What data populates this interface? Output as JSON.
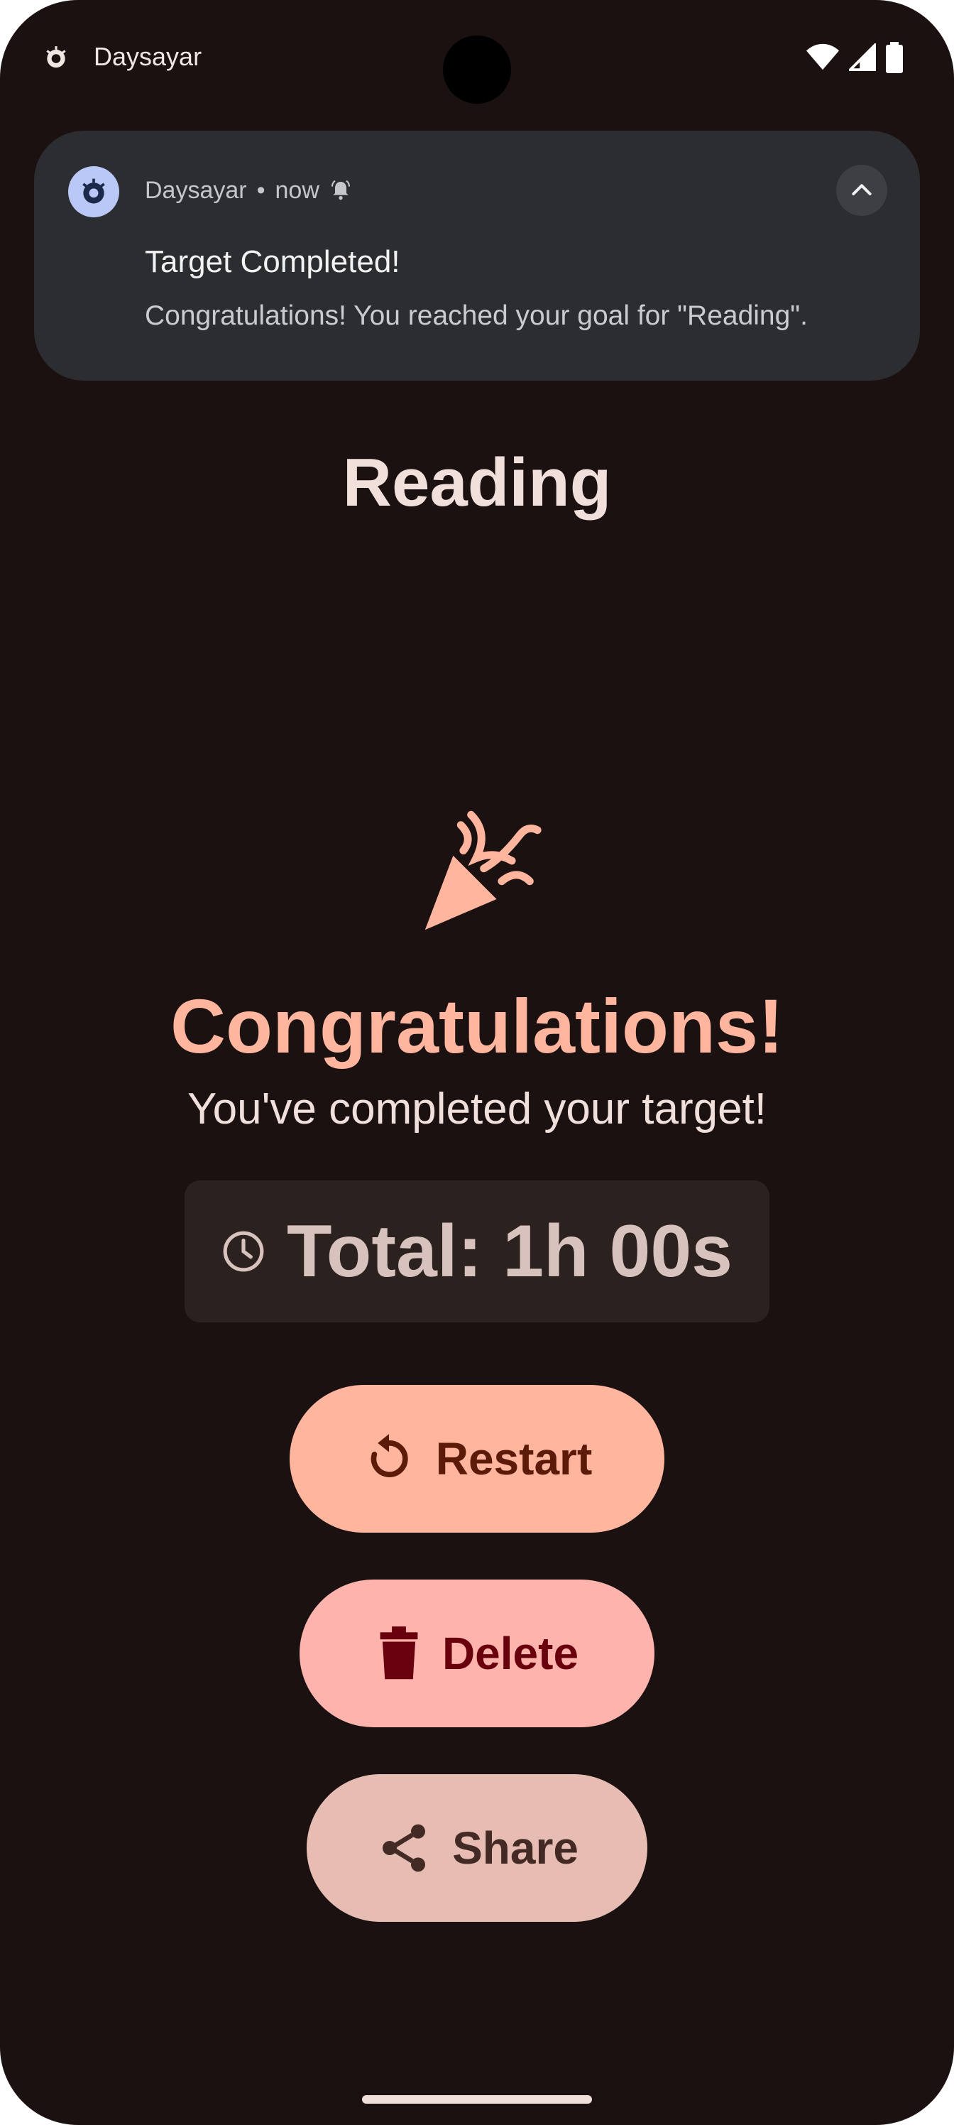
{
  "status_bar": {
    "app_name": "Daysayar",
    "icons": [
      "app-icon",
      "wifi-icon",
      "signal-icon",
      "battery-icon"
    ]
  },
  "notification": {
    "app_name": "Daysayar",
    "separator": "•",
    "time": "now",
    "title": "Target Completed!",
    "body": "Congratulations! You reached your goal for \"Reading\".",
    "icons": [
      "app-avatar-icon",
      "bell-icon",
      "chevron-up-icon"
    ]
  },
  "main": {
    "title": "Reading",
    "congrats": "Congratulations!",
    "subtitle": "You've completed your target!",
    "total": "Total: 1h 00s"
  },
  "buttons": {
    "restart": "Restart",
    "delete": "Delete",
    "share": "Share"
  },
  "colors": {
    "background": "#1a1110",
    "accent": "#ffb59e",
    "restart_bg": "#ffb59e",
    "delete_bg": "#ffb3ad",
    "share_bg": "#e7bdb3"
  }
}
